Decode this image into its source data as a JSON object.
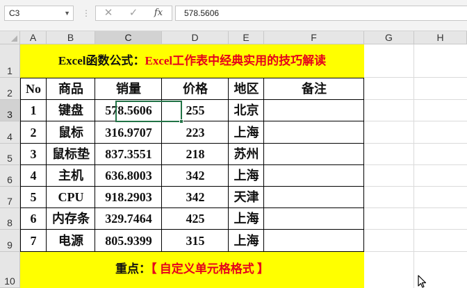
{
  "formula_bar": {
    "name_box": "C3",
    "cancel_icon": "✕",
    "enter_icon": "✓",
    "fx_label": "fx",
    "formula_value": "578.5606"
  },
  "columns": [
    "A",
    "B",
    "C",
    "D",
    "E",
    "F",
    "G",
    "H"
  ],
  "rows": [
    "1",
    "2",
    "3",
    "4",
    "5",
    "6",
    "7",
    "8",
    "9",
    "10"
  ],
  "selected_cell": "C3",
  "sheet": {
    "title_black": "Excel函数公式：",
    "title_red": "Excel工作表中经典实用的技巧解读",
    "headers": [
      "No",
      "商品",
      "销量",
      "价格",
      "地区",
      "备注"
    ],
    "data_rows": [
      [
        "1",
        "键盘",
        "578.5606",
        "255",
        "北京",
        ""
      ],
      [
        "2",
        "鼠标",
        "316.9707",
        "223",
        "上海",
        ""
      ],
      [
        "3",
        "鼠标垫",
        "837.3551",
        "218",
        "苏州",
        ""
      ],
      [
        "4",
        "主机",
        "636.8003",
        "342",
        "上海",
        ""
      ],
      [
        "5",
        "CPU",
        "918.2903",
        "342",
        "天津",
        ""
      ],
      [
        "6",
        "内存条",
        "329.7464",
        "425",
        "上海",
        ""
      ],
      [
        "7",
        "电源",
        "805.9399",
        "315",
        "上海",
        ""
      ]
    ],
    "footer_black": "重点：",
    "footer_red": "【 自定义单元格格式 】"
  },
  "colors": {
    "highlight_fill": "#ffff00",
    "title_red": "#e5001c",
    "selection_green": "#217346"
  },
  "icons": {
    "name_box_dropdown": "chevron-down-icon",
    "mouse_pointer": "mouse-cursor-icon"
  }
}
